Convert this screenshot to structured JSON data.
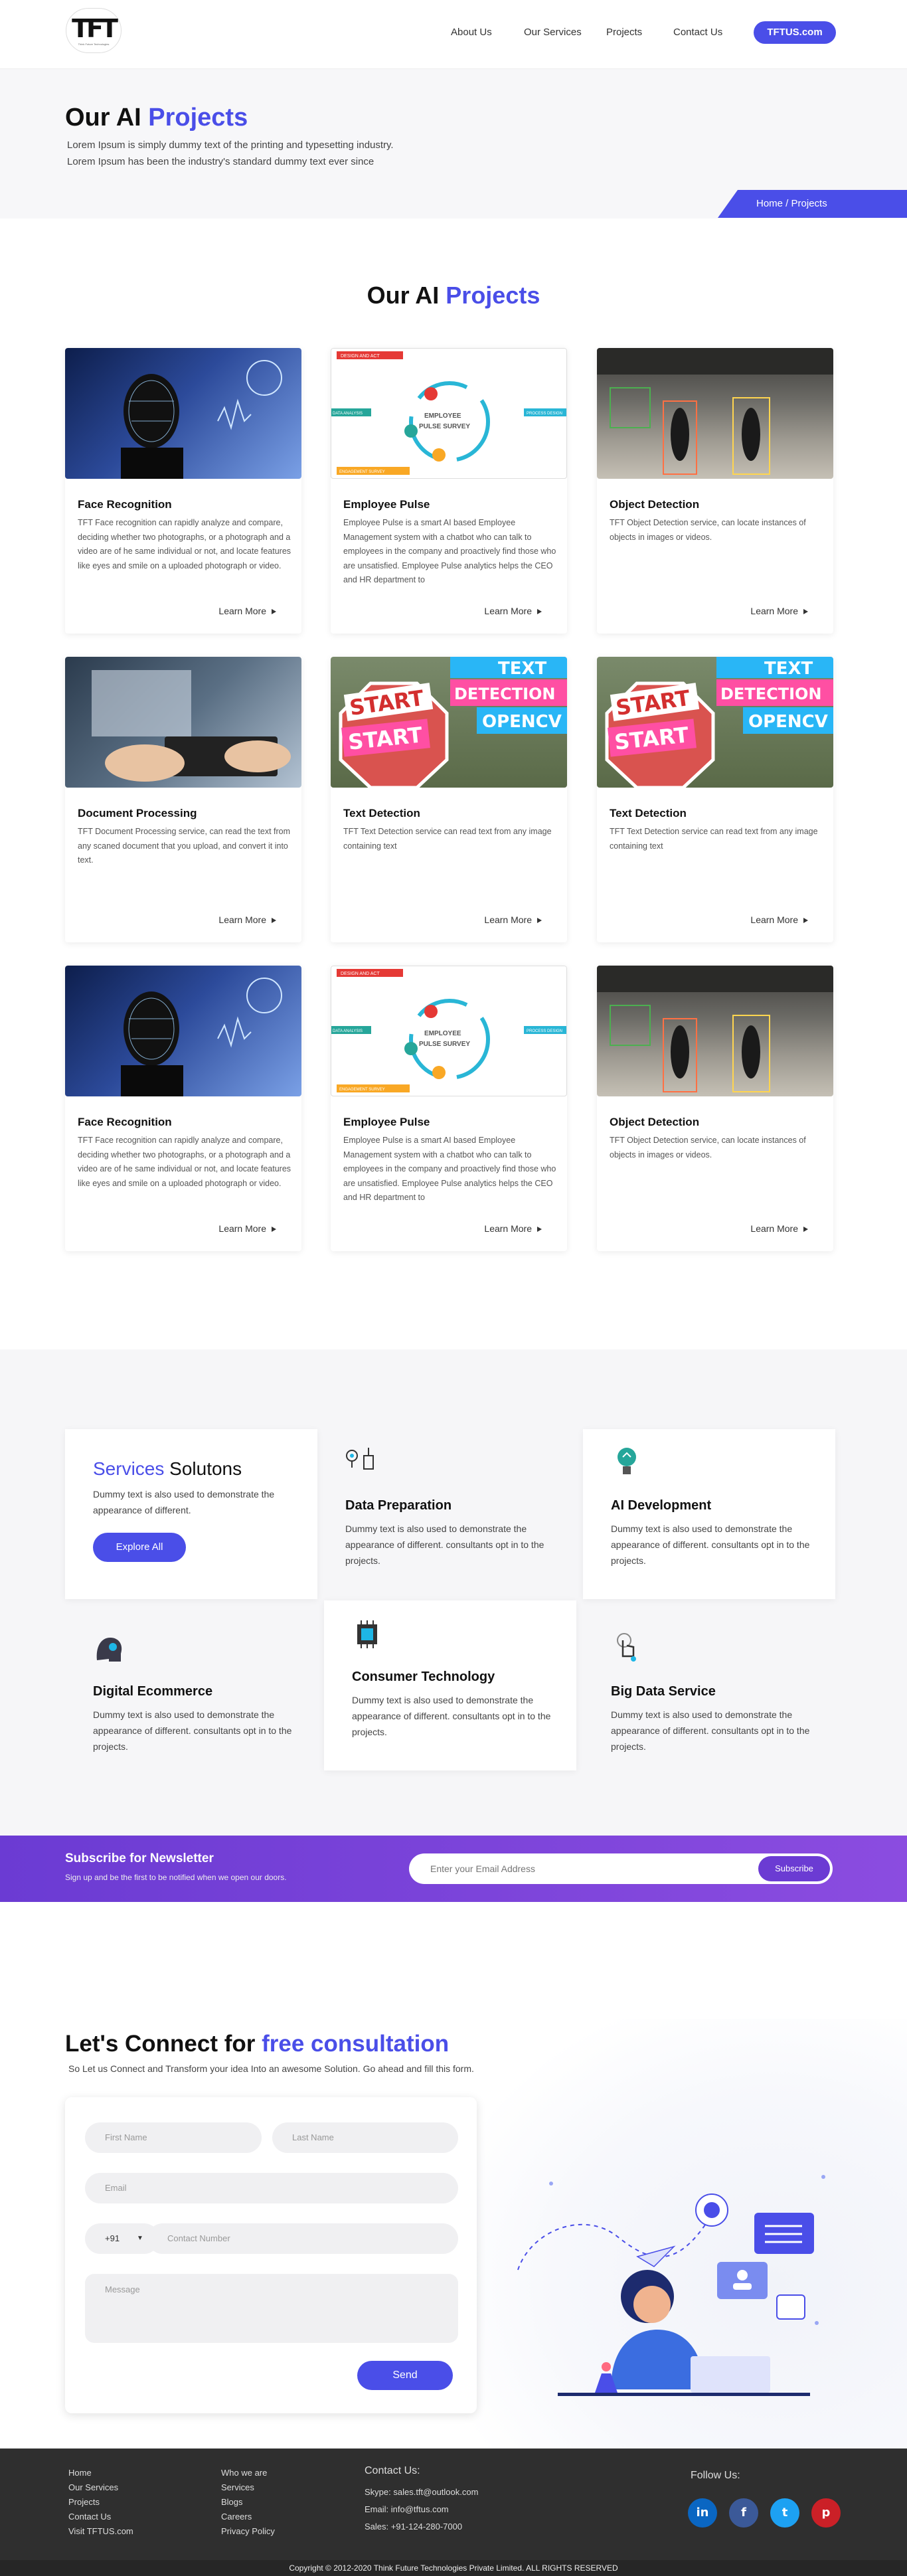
{
  "header": {
    "logo_text": "TFT",
    "logo_sub": "Think Future Technologies",
    "nav": [
      "About Us",
      "Our Services",
      "Projects",
      "Contact Us"
    ],
    "cta": "TFTUS.com"
  },
  "hero": {
    "title_plain": "Our AI ",
    "title_accent": "Projects",
    "line1": "Lorem Ipsum is simply dummy text of the printing and typesetting industry.",
    "line2": "Lorem Ipsum has been the industry's standard dummy text ever since",
    "breadcrumb": "Home / Projects"
  },
  "projects": {
    "title_plain": "Our AI ",
    "title_accent": "Projects",
    "learn_more": "Learn More",
    "cards": [
      {
        "title": "Face Recognition",
        "desc": "TFT Face recognition can rapidly analyze and compare, deciding whether two photographs, or a photograph and a video are of he same individual or not, and locate features like eyes and smile on a uploaded photograph or video."
      },
      {
        "title": "Employee Pulse",
        "desc": "Employee Pulse is a smart AI based Employee Management system with a chatbot who can talk to employees in the company and proactively find those who are unsatisfied. Employee Pulse analytics helps the CEO and HR department to"
      },
      {
        "title": "Object Detection",
        "desc": "TFT Object Detection service, can locate instances of objects in images or videos."
      },
      {
        "title": "Document Processing",
        "desc": "TFT Document Processing service, can read the text from any scaned document that you upload, and convert it into text."
      },
      {
        "title": "Text Detection",
        "desc": "TFT Text Detection service can read text from any image containing text"
      },
      {
        "title": "Text Detection",
        "desc": "TFT Text Detection service can read text from any image containing text"
      },
      {
        "title": "Face Recognition",
        "desc": "TFT Face recognition can rapidly analyze and compare, deciding whether two photographs, or a photograph and a video are of he same individual or not, and locate features like eyes and smile on a uploaded photograph or video."
      },
      {
        "title": "Employee Pulse",
        "desc": "Employee Pulse is a smart AI based Employee Management system with a chatbot who can talk to employees in the company and proactively find those who are unsatisfied. Employee Pulse analytics helps the CEO and HR department to"
      },
      {
        "title": "Object Detection",
        "desc": "TFT Object Detection service, can locate instances of objects in images or videos."
      }
    ],
    "pulse_img": {
      "top": "DESIGN AND ACT",
      "center1": "EMPLOYEE",
      "center2": "PULSE SURVEY",
      "left": "DATA ANALYSIS",
      "right": "PROCESS DESIGN",
      "bottom": "ENGAGEMENT SURVEY"
    },
    "text_img": {
      "sign1": "START",
      "sign2": "START",
      "b1": "TEXT",
      "b2": "DETECTION",
      "b3": "OPENCV"
    }
  },
  "services": {
    "title_accent": "Services",
    "title_plain": " Solutons",
    "intro": "Dummy text is also used to demonstrate the appearance of different.",
    "explore": "Explore All",
    "item_desc": "Dummy text is also used to demonstrate the appearance of different. consultants opt in to the projects.",
    "items": [
      "Data Preparation",
      "AI Development",
      "Digital Ecommerce",
      "Consumer Technology",
      "Big Data Service"
    ]
  },
  "newsletter": {
    "title": "Subscribe for Newsletter",
    "sub": "Sign up and be the first to be notified when we open our doors.",
    "placeholder": "Enter your Email Address",
    "button": "Subscribe"
  },
  "connect": {
    "title_plain": "Let's Connect for ",
    "title_accent": "free consultation",
    "sub": "So Let us Connect and Transform your idea Into an awesome Solution. Go ahead and fill this form.",
    "first_name": "First Name",
    "last_name": "Last Name",
    "email": "Email",
    "code": "+91",
    "contact": "Contact Number",
    "message": "Message",
    "send": "Send"
  },
  "footer": {
    "col1": [
      "Home",
      "Our Services",
      "Projects",
      "Contact Us",
      "Visit TFTUS.com"
    ],
    "col2": [
      "Who we are",
      "Services",
      "Blogs",
      "Careers",
      "Privacy Policy"
    ],
    "contact_title": "Contact Us:",
    "skype": "Skype: sales.tft@outlook.com",
    "email": "Email: info@tftus.com",
    "sales": "Sales: +91-124-280-7000",
    "follow": "Follow Us:",
    "social": [
      {
        "name": "linkedin-icon",
        "glyph": "in",
        "color": "#0a66c2"
      },
      {
        "name": "facebook-icon",
        "glyph": "f",
        "color": "#3b5998"
      },
      {
        "name": "twitter-icon",
        "glyph": "t",
        "color": "#1da1f2"
      },
      {
        "name": "pinterest-icon",
        "glyph": "p",
        "color": "#cb2027"
      }
    ],
    "copyright": "Copyright © 2012-2020 Think Future Technologies Private Limited. ALL RIGHTS RESERVED"
  },
  "colors": {
    "accent": "#4a4ee8",
    "purple": "#6b3bd3",
    "footer": "#2f2f2f"
  }
}
